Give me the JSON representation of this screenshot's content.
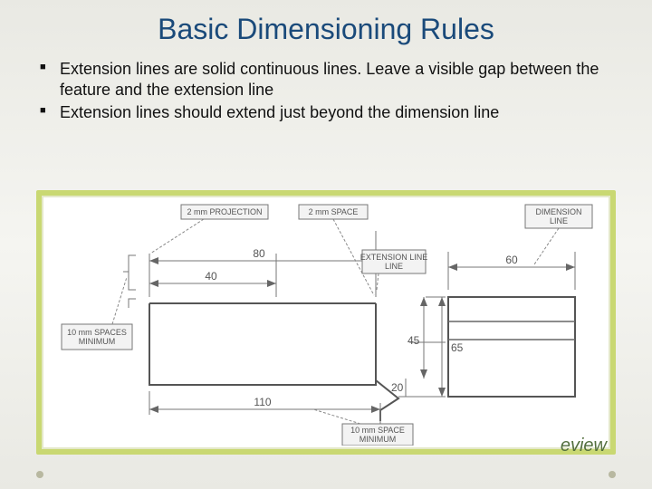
{
  "title": "Basic Dimensioning Rules",
  "bullets": [
    "Extension lines are solid continuous lines. Leave a visible gap between the feature and the extension line",
    "Extension lines should extend just beyond the dimension line"
  ],
  "partial_text": "eview",
  "diagram": {
    "callouts": {
      "projection": "2 mm PROJECTION",
      "space_label": "2 mm SPACE",
      "extension_line": "EXTENSION LINE",
      "dimension_line": "DIMENSION LINE",
      "spaces_min_l1": "10 mm SPACES",
      "spaces_min_l2": "MINIMUM",
      "space_min_l1": "10 mm SPACE",
      "space_min_l2": "MINIMUM"
    },
    "dims": {
      "d80": "80",
      "d40": "40",
      "d60": "60",
      "d65": "65",
      "d45": "45",
      "d20": "20",
      "d110": "110"
    }
  }
}
